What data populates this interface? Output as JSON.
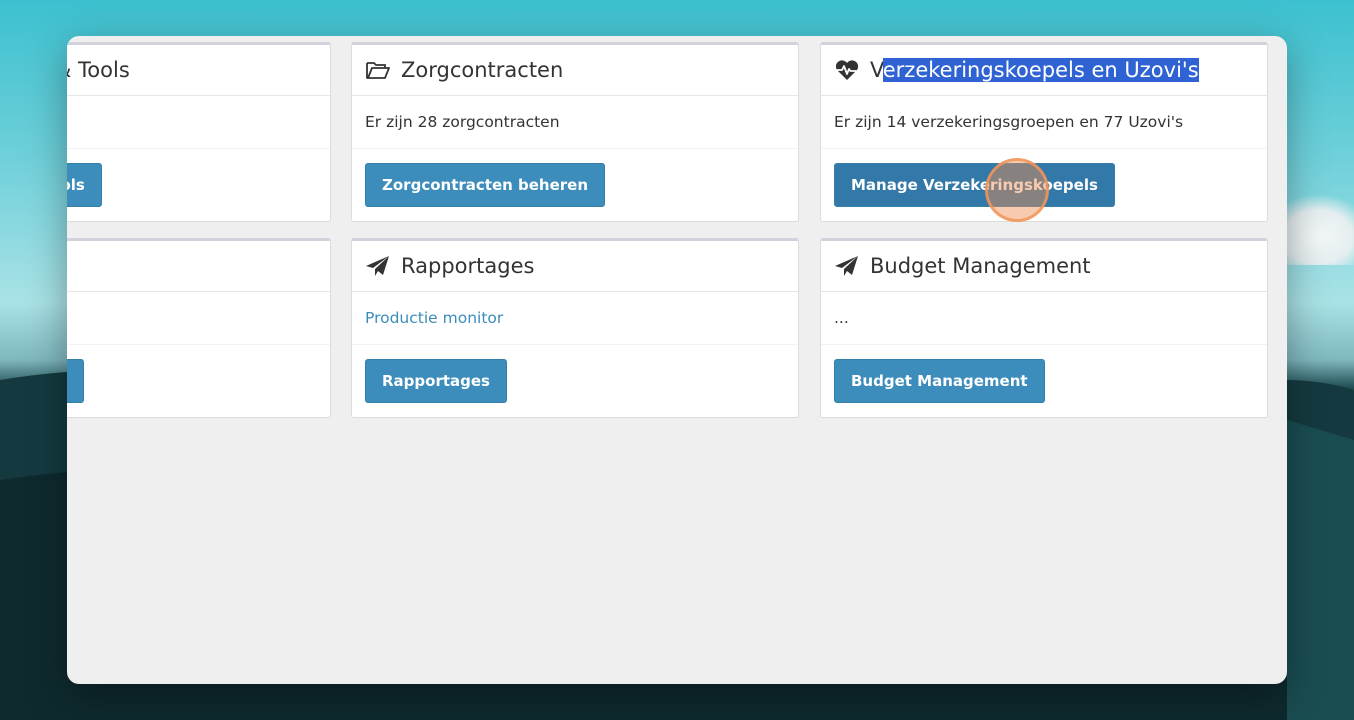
{
  "cards": {
    "tools": {
      "title_partial": "& Tools",
      "button_partial": "tools"
    },
    "zorgcontracten": {
      "title": "Zorgcontracten",
      "description": "Er zijn 28 zorgcontracten",
      "button": "Zorgcontracten beheren"
    },
    "verzekeringskoepels": {
      "title_start": "V",
      "title_selected": "erzekeringskoepels en Uzovi's",
      "description": "Er zijn 14 verzekeringsgroepen en 77 Uzovi's",
      "button": "Manage Verzekeringskoepels"
    },
    "rapportages": {
      "title": "Rapportages",
      "link": "Productie monitor",
      "button": "Rapportages"
    },
    "budget": {
      "title": "Budget Management",
      "description": "...",
      "button": "Budget Management"
    }
  },
  "icons": {
    "zorgcontracten": "folder-open-icon",
    "verzekeringskoepels": "heartbeat-icon",
    "rapportages": "paper-plane-icon",
    "budget": "paper-plane-icon"
  },
  "colors": {
    "button": "#3c8dbc",
    "button_active": "#3278a8",
    "selection": "#2f63d3",
    "link": "#3c8dbc",
    "click_indicator": "#f08c50"
  }
}
